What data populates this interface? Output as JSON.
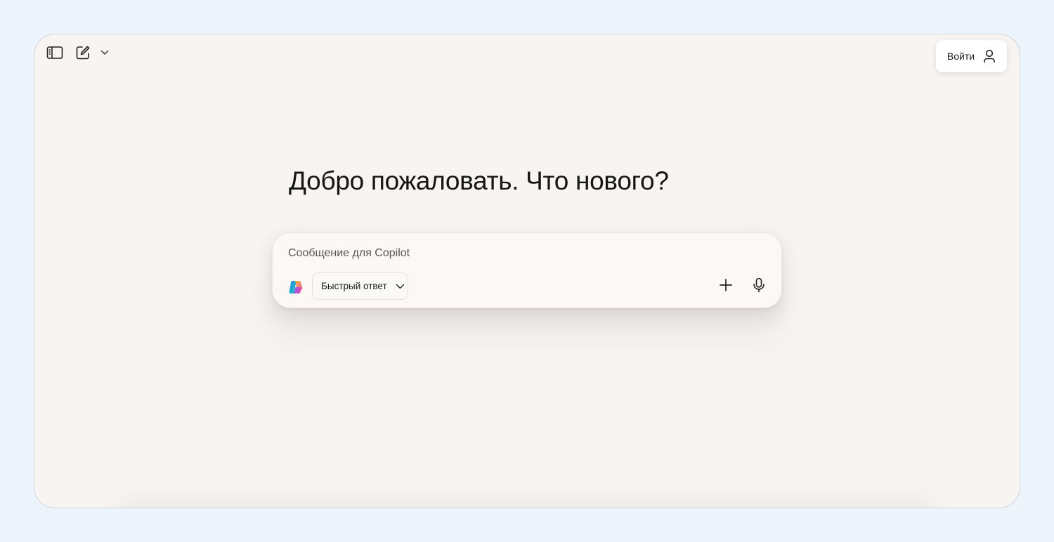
{
  "header": {
    "sign_in_label": "Войти",
    "icons": [
      "sidebar-toggle-icon",
      "new-chat-icon",
      "chevron-down-icon",
      "user-icon"
    ]
  },
  "main": {
    "headline": "Добро пожаловать. Что нового?"
  },
  "composer": {
    "placeholder": "Сообщение для Copilot",
    "value": "",
    "mode_label": "Быстрый ответ",
    "icons": [
      "copilot-logo-icon",
      "chevron-down-icon",
      "plus-icon",
      "microphone-icon"
    ]
  },
  "colors": {
    "outer_background": "#eef4fc",
    "window_background": "#f7f4f2",
    "text_primary": "#161616",
    "surface_white": "#ffffff"
  }
}
